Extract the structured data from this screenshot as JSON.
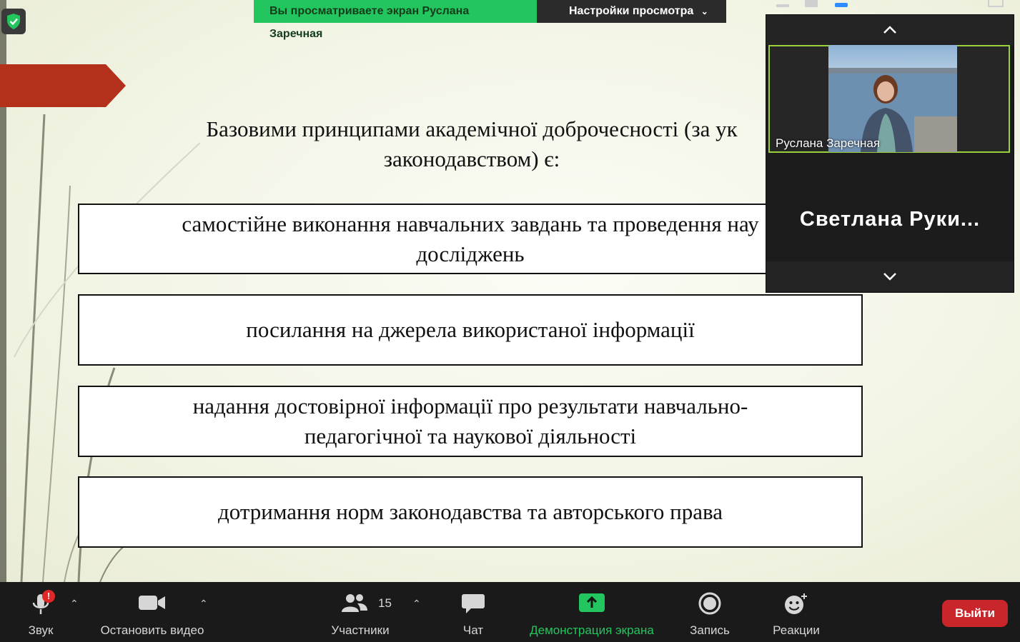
{
  "share_banner": {
    "viewing_text": "Вы просматриваете экран Руслана Заречная",
    "view_options": "Настройки просмотра"
  },
  "slide": {
    "title": "Базовими принципами академічної доброчесності (за ук\nзаконодавством) є:",
    "boxes": [
      "самостійне виконання навчальних завдань та проведення нау\nдосліджень",
      "посилання на джерела використаної інформації",
      "надання достовірної інформації про результати навчально-\nпедагогічної та наукової діяльності",
      "дотримання норм законодавства та авторського права"
    ],
    "colors": {
      "banner": "#b3311b",
      "background": "#f4f6e8"
    }
  },
  "video_panel": {
    "participant1_name": "Руслана Заречная",
    "participant2_name": "Светлана  Руки...",
    "active_speaker_border": "#9ad13a"
  },
  "toolbar": {
    "audio_label": "Звук",
    "video_label": "Остановить видео",
    "participants_label": "Участники",
    "participants_count": "15",
    "chat_label": "Чат",
    "share_label": "Демонстрация экрана",
    "record_label": "Запись",
    "reactions_label": "Реакции",
    "leave_label": "Выйти",
    "audio_alert": "!",
    "share_color": "#23c55e",
    "leave_color": "#c8262a"
  }
}
